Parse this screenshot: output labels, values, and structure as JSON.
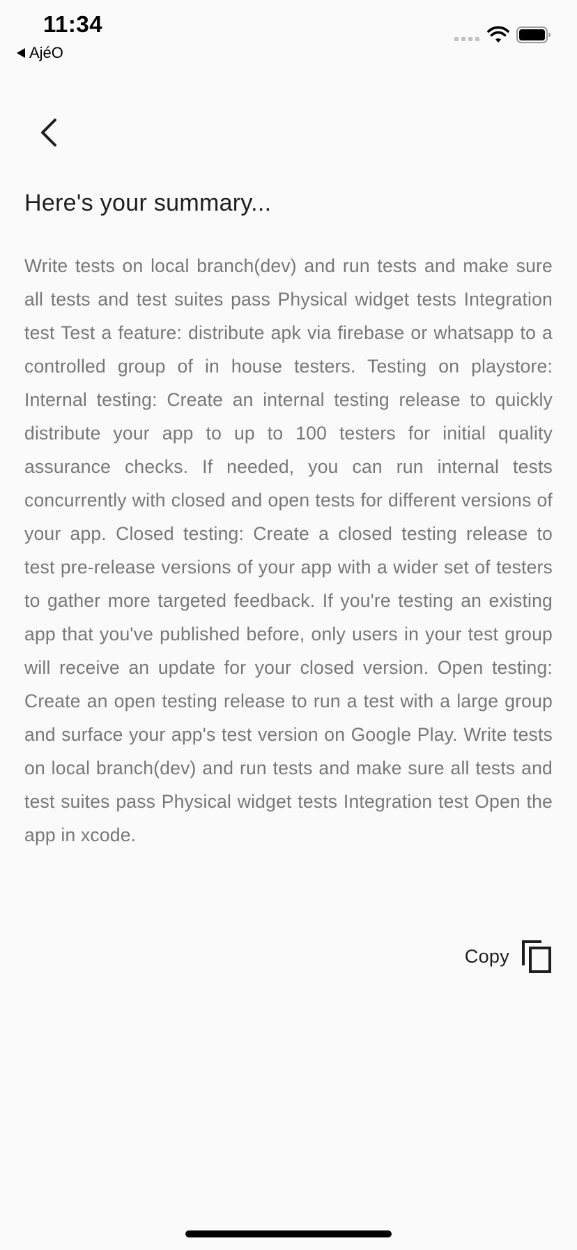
{
  "status_bar": {
    "time": "11:34",
    "back_app": "AjéO",
    "icons": [
      "signal-dots-icon",
      "wifi-icon",
      "battery-icon"
    ]
  },
  "navigation": {
    "back_icon": "chevron-left-icon"
  },
  "summary": {
    "title": "Here's your summary...",
    "body": "Write tests on local branch(dev) and run tests and make sure all tests and test suites pass Physical widget tests Integration test Test a feature: distribute apk via firebase or whatsapp to a controlled group of in house testers. Testing on playstore: Internal testing: Create an internal testing release to quickly distribute your app to up to 100 testers for initial quality assurance checks. If needed, you can run internal tests concurrently with closed and open tests for different versions of your app. Closed testing: Create a closed testing release to test pre-release versions of your app with a wider set of testers to gather more targeted feedback. If you're testing an existing app that you've published before, only users in your test group will receive an update for your closed version. Open testing: Create an open testing release to run a test with a large group and surface your app's test version on Google Play. Write tests on local branch(dev) and run tests and make sure all tests and test suites pass Physical widget tests Integration test Open the app in xcode."
  },
  "actions": {
    "copy_label": "Copy",
    "copy_icon": "copy-icon"
  },
  "colors": {
    "background": "#fafafa",
    "title": "#1e1e1e",
    "body_text": "#777777"
  }
}
